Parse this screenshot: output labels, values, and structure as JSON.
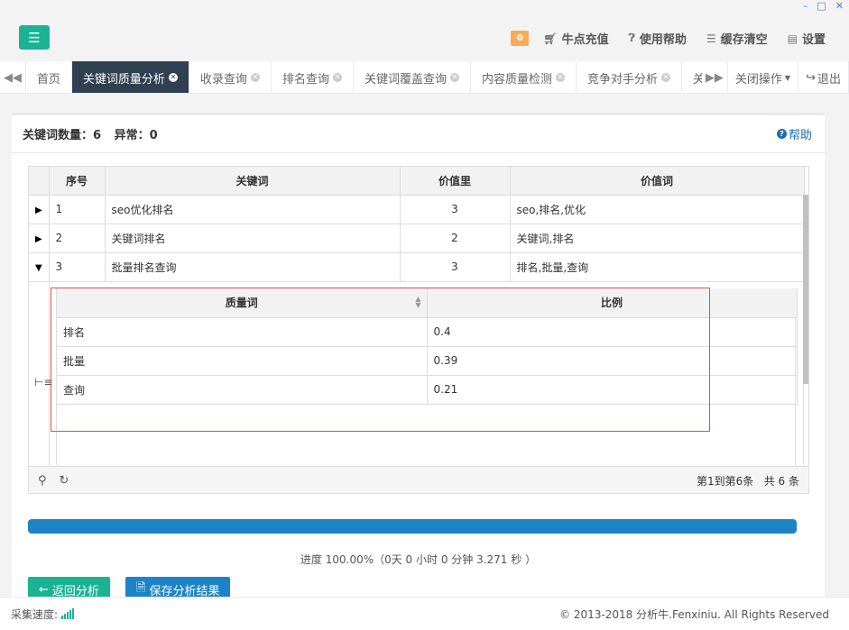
{
  "header": {
    "badge_count": "0",
    "recharge": "牛点充值",
    "help": "使用帮助",
    "clear_cache": "缓存清空",
    "settings": "设置"
  },
  "tabs": [
    {
      "label": "首页"
    },
    {
      "label": "关键词质量分析",
      "active": true
    },
    {
      "label": "收录查询"
    },
    {
      "label": "排名查询"
    },
    {
      "label": "关键词覆盖查询"
    },
    {
      "label": "内容质量检测"
    },
    {
      "label": "竞争对手分析"
    },
    {
      "label": "关键词"
    }
  ],
  "tab_controls": {
    "close_ops": "关闭操作",
    "logout": "退出"
  },
  "panel": {
    "keyword_count_label": "关键词数量：6",
    "abnormal_label": "异常：0",
    "help_label": "帮助"
  },
  "table": {
    "headers": [
      "序号",
      "关键词",
      "价值里",
      "价值词"
    ],
    "rows": [
      {
        "index": "1",
        "keyword": "seo优化排名",
        "value": "3",
        "words": "seo,排名,优化",
        "expanded": false
      },
      {
        "index": "2",
        "keyword": "关键词排名",
        "value": "2",
        "words": "关键词,排名",
        "expanded": false
      },
      {
        "index": "3",
        "keyword": "批量排名查询",
        "value": "3",
        "words": "排名,批量,查询",
        "expanded": true
      }
    ]
  },
  "subtable": {
    "headers": [
      "质量词",
      "比例"
    ],
    "rows": [
      {
        "word": "排名",
        "ratio": "0.4"
      },
      {
        "word": "批量",
        "ratio": "0.39"
      },
      {
        "word": "查询",
        "ratio": "0.21"
      }
    ]
  },
  "pager": {
    "range": "第1到第6条",
    "total": "共 6 条"
  },
  "progress": {
    "percent": 100,
    "text": "进度 100.00%（0天 0 小时 0 分钟 3.271 秒 ）"
  },
  "buttons": {
    "back": "返回分析",
    "save": "保存分析结果"
  },
  "footer": {
    "speed_label": "采集速度:",
    "copyright": "© 2013-2018 分析牛.Fenxiniu. All Rights Reserved"
  },
  "colors": {
    "accent_green": "#1ab394",
    "accent_blue": "#1c84c6",
    "tab_active": "#2f4050",
    "badge": "#f8ac59",
    "highlight_border": "#d9534f"
  }
}
